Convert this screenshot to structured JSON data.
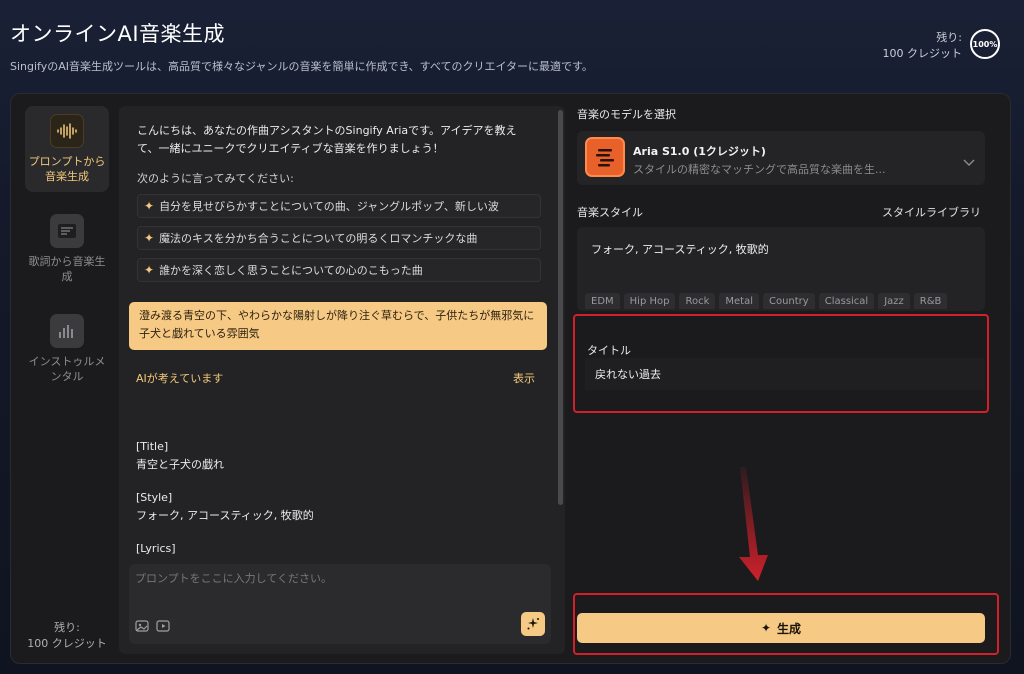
{
  "header": {
    "title": "オンラインAI音楽生成",
    "subtitle": "SingifyのAI音楽生成ツールは、高品質で様々なジャンルの音楽を簡単に作成でき、すべてのクリエイターに最適です。",
    "credits_label": "残り:",
    "credits_value": "100 クレジット",
    "credits_percent": "100%"
  },
  "nav": {
    "items": [
      {
        "label": "プロンプトから音楽生成",
        "icon": "waveform-icon",
        "active": true
      },
      {
        "label": "歌詞から音楽生成",
        "icon": "lyrics-icon",
        "active": false
      },
      {
        "label": "インストゥルメンタル",
        "icon": "equalizer-icon",
        "active": false
      }
    ],
    "credits_label": "残り:",
    "credits_value": "100 クレジット"
  },
  "chat": {
    "intro": "こんにちは、あなたの作曲アシスタントのSingify Ariaです。アイデアを教えて、一緒にユニークでクリエイティブな音楽を作りましょう！",
    "say_like": "次のように言ってみてください:",
    "suggestions": [
      "自分を見せびらかすことについての曲、ジャングルポップ、新しい波",
      "魔法のキスを分かち合うことについての明るくロマンチックな曲",
      "誰かを深く恋しく思うことについての心のこもった曲"
    ],
    "user_prompt": "澄み渡る青空の下、やわらかな陽射しが降り注ぐ草むらで、子供たちが無邪気に子犬と戯れている雰囲気",
    "thinking": "AIが考えています",
    "show": "表示",
    "result_title_tag": "[Title]",
    "result_title": "青空と子犬の戯れ",
    "result_style_tag": "[Style]",
    "result_style": "フォーク, アコースティック, 牧歌的",
    "result_lyrics_tag": "[Lyrics]",
    "input_placeholder": "プロンプトをここに入力してください。"
  },
  "model": {
    "section_label": "音楽のモデルを選択",
    "name": "Aria S1.0 (1クレジット)",
    "description": "スタイルの精密なマッチングで高品質な楽曲を生...",
    "icon": "aria-model-icon",
    "icon_color": "#e8612a"
  },
  "style": {
    "section_label": "音楽スタイル",
    "library_link": "スタイルライブラリ",
    "value": "フォーク, アコースティック, 牧歌的",
    "tags": [
      "EDM",
      "Hip Hop",
      "Rock",
      "Metal",
      "Country",
      "Classical",
      "Jazz",
      "R&B"
    ]
  },
  "title_field": {
    "label": "タイトル",
    "value": "戻れない過去"
  },
  "generate": {
    "label": "生成",
    "icon": "sparkle-icon"
  },
  "colors": {
    "accent": "#f6c984",
    "highlight_box": "#d0202a",
    "arrow": "#d0202a"
  }
}
